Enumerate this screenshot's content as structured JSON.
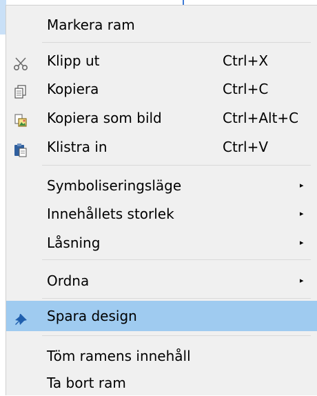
{
  "menu": {
    "items": [
      {
        "label": "Markera ram"
      },
      {
        "label": "Klipp ut",
        "shortcut": "Ctrl+X",
        "icon": "scissors-icon"
      },
      {
        "label": "Kopiera",
        "shortcut": "Ctrl+C",
        "icon": "copy-icon"
      },
      {
        "label": "Kopiera som bild",
        "shortcut": "Ctrl+Alt+C",
        "icon": "copy-as-image-icon"
      },
      {
        "label": "Klistra in",
        "shortcut": "Ctrl+V",
        "icon": "paste-icon"
      },
      {
        "label": "Symboliseringsläge",
        "submenu": "▸"
      },
      {
        "label": "Innehållets storlek",
        "submenu": "▸"
      },
      {
        "label": "Låsning",
        "submenu": "▸"
      },
      {
        "label": "Ordna",
        "submenu": "▸"
      },
      {
        "label": "Spara design",
        "icon": "pin-icon",
        "highlighted": true
      },
      {
        "label": "Töm ramens innehåll"
      },
      {
        "label": "Ta bort ram"
      }
    ]
  },
  "colors": {
    "menu_bg": "#f0f0f0",
    "highlight": "#9fcbf0",
    "separator": "#d9d9d9"
  }
}
